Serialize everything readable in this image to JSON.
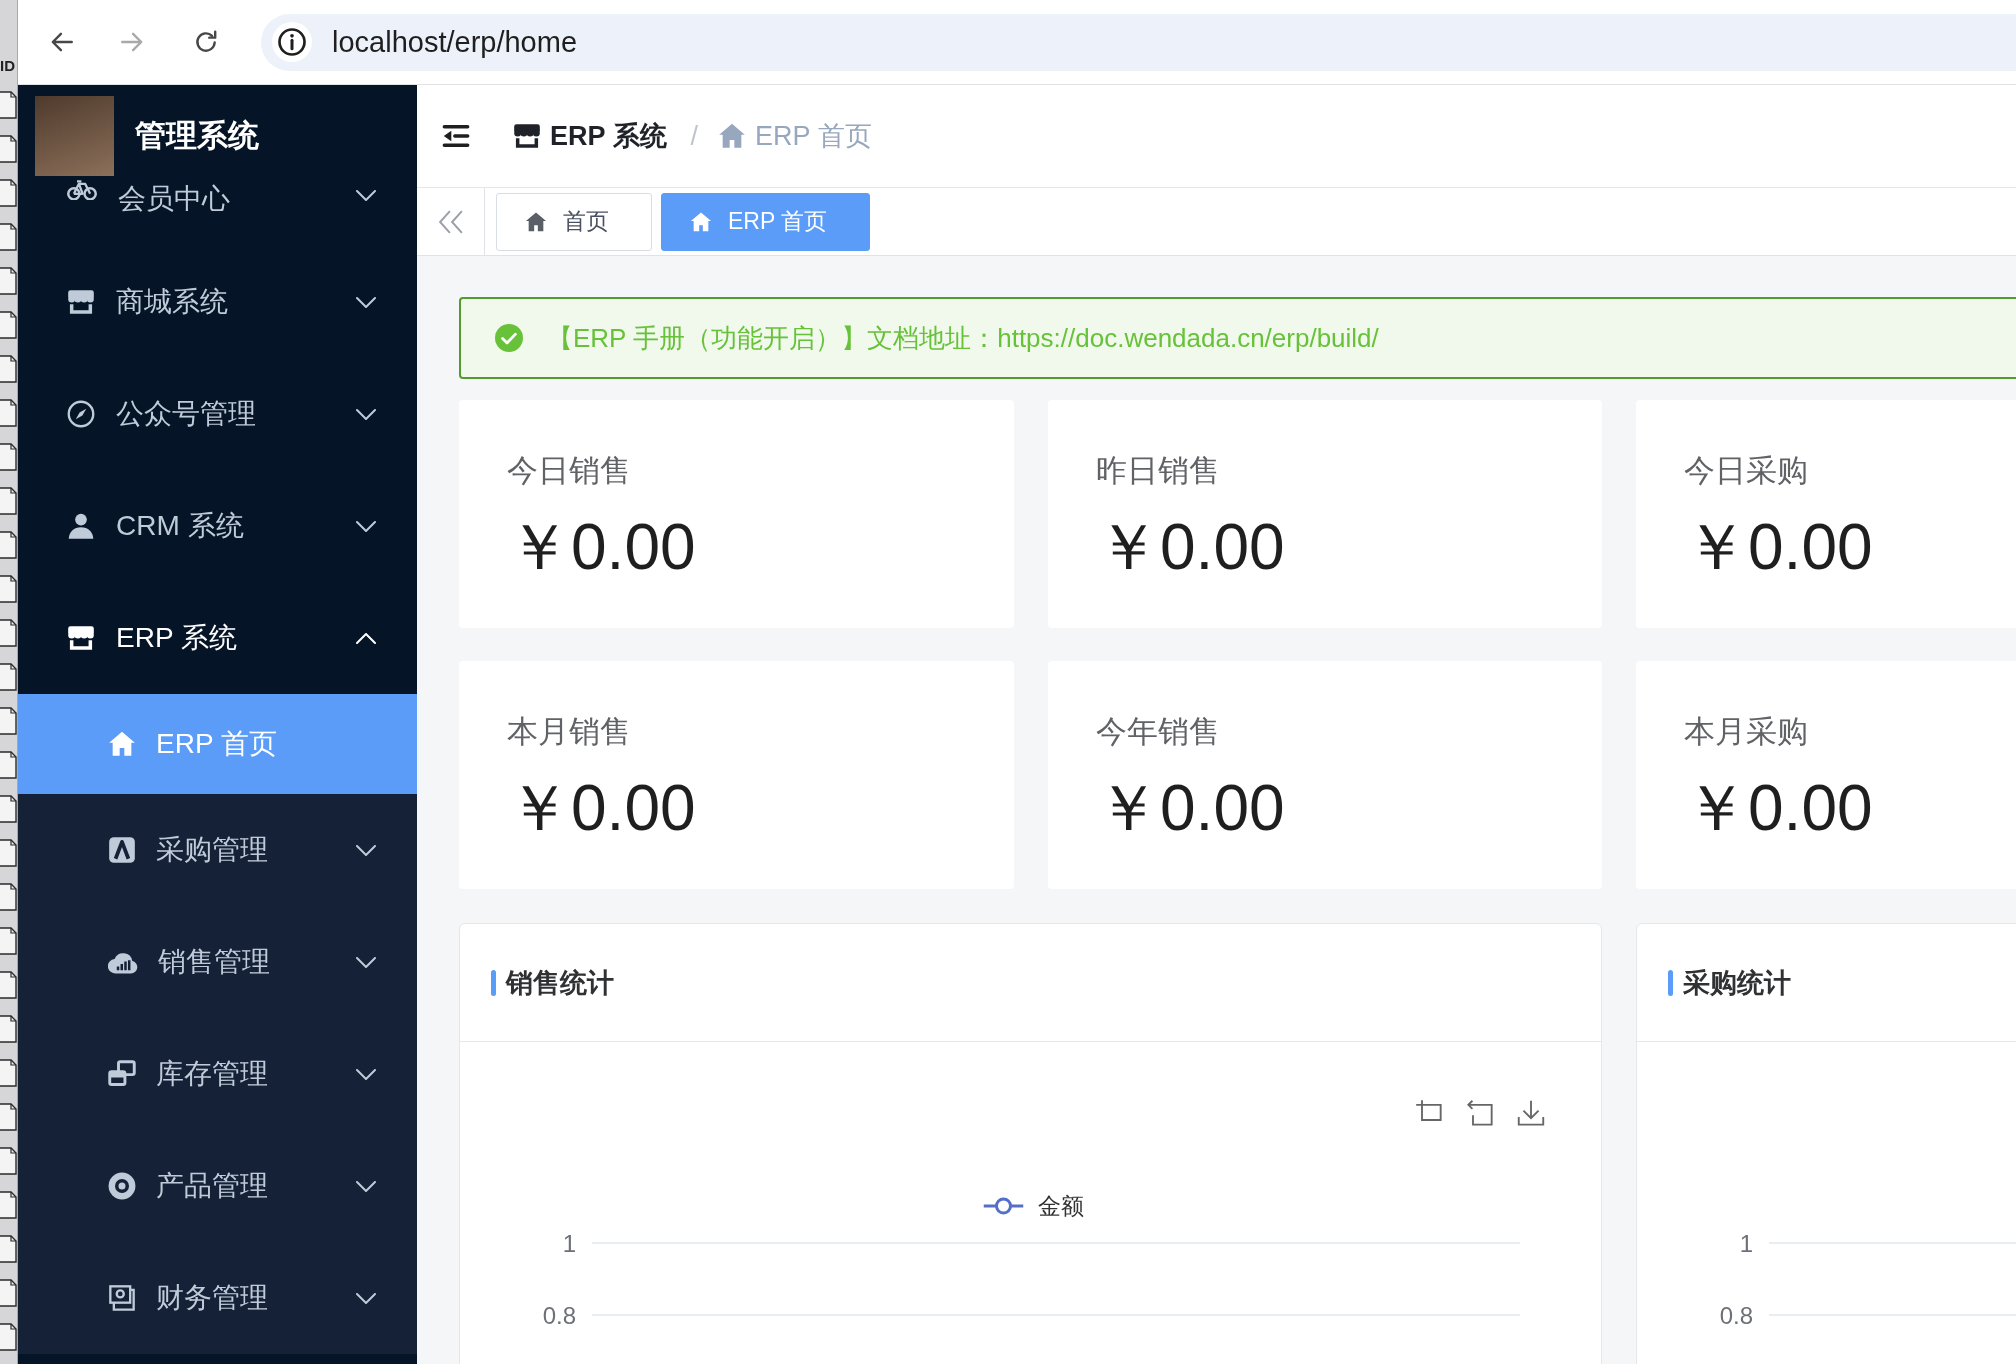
{
  "desktop": {
    "label": "ID"
  },
  "browser": {
    "url": "localhost/erp/home",
    "forward_disabled": true
  },
  "sidebar": {
    "title": "管理系统",
    "menu": [
      {
        "label": "会员中心",
        "selected": false,
        "expanded": false
      },
      {
        "label": "商城系统",
        "selected": false,
        "expanded": false
      },
      {
        "label": "公众号管理",
        "selected": false,
        "expanded": false
      },
      {
        "label": "CRM 系统",
        "selected": false,
        "expanded": false
      },
      {
        "label": "ERP 系统",
        "selected": false,
        "expanded": true,
        "children": [
          {
            "label": "ERP 首页",
            "selected": true
          },
          {
            "label": "采购管理",
            "selected": false,
            "expanded": false
          },
          {
            "label": "销售管理",
            "selected": false,
            "expanded": false
          },
          {
            "label": "库存管理",
            "selected": false,
            "expanded": false
          },
          {
            "label": "产品管理",
            "selected": false,
            "expanded": false
          },
          {
            "label": "财务管理",
            "selected": false,
            "expanded": false
          }
        ]
      }
    ]
  },
  "breadcrumb": {
    "separator": "/",
    "items": [
      {
        "label": "ERP 系统"
      },
      {
        "label": "ERP 首页"
      }
    ]
  },
  "tags": [
    {
      "label": "首页",
      "selected": false
    },
    {
      "label": "ERP 首页",
      "selected": true
    }
  ],
  "alert": {
    "text": "【ERP 手册（功能开启）】文档地址：https://doc.wendada.cn/erp/build/"
  },
  "stats": [
    {
      "label": "今日销售",
      "value": "￥0.00"
    },
    {
      "label": "昨日销售",
      "value": "￥0.00"
    },
    {
      "label": "今日采购",
      "value": "￥0.00"
    },
    {
      "label": "本月销售",
      "value": "￥0.00"
    },
    {
      "label": "今年销售",
      "value": "￥0.00"
    },
    {
      "label": "本月采购",
      "value": "￥0.00"
    }
  ],
  "charts": [
    {
      "title": "销售统计",
      "toolbox": true,
      "legend": [
        {
          "name": "金额"
        }
      ],
      "axis_labels": [
        "1",
        "0.8"
      ]
    },
    {
      "title": "采购统计",
      "axis_labels": [
        "1",
        "0.8"
      ]
    }
  ]
}
